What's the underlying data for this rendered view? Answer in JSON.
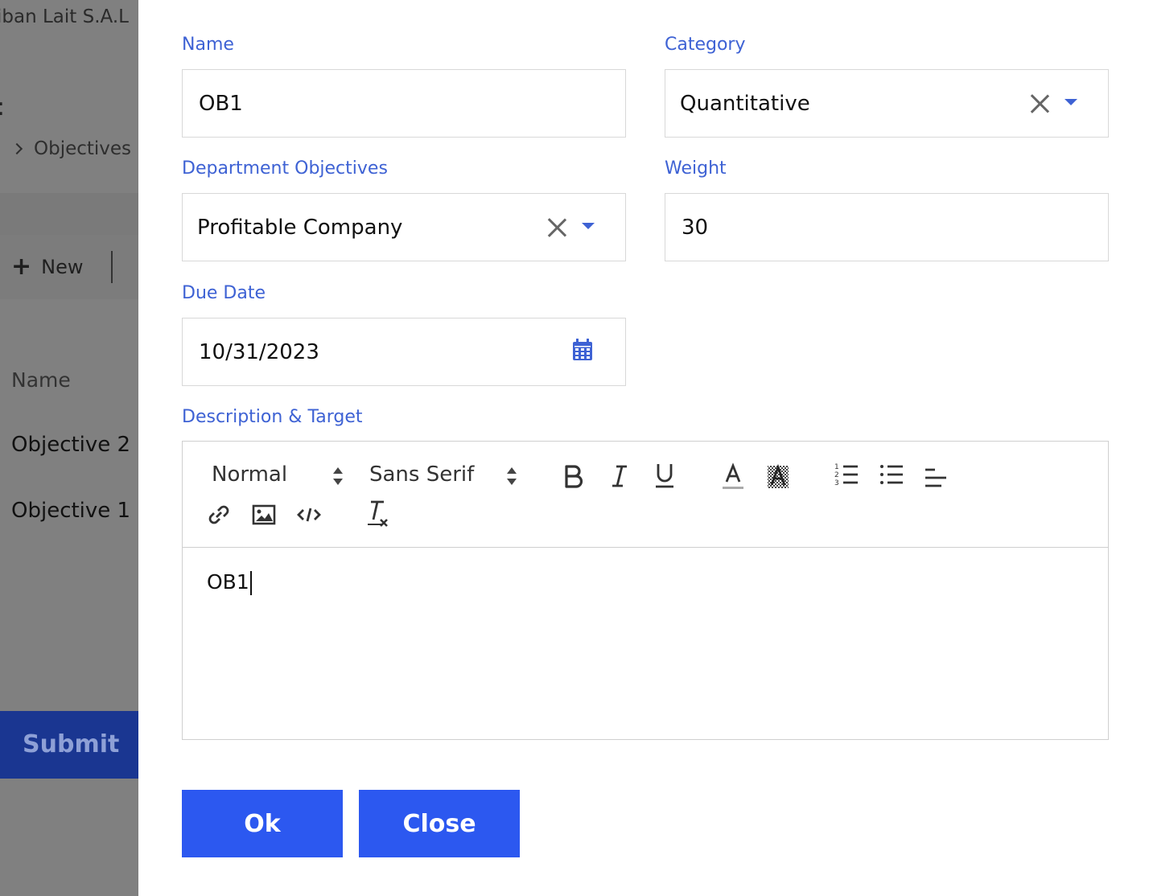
{
  "background": {
    "company_name": "iban Lait S.A.L",
    "colon": ":",
    "breadcrumb_item": "Objectives",
    "new_label": "New",
    "column_name": "Name",
    "rows": [
      "Objective 2",
      "Objective 1"
    ],
    "submit_label": "Submit"
  },
  "form": {
    "name": {
      "label": "Name",
      "value": "OB1"
    },
    "category": {
      "label": "Category",
      "value": "Quantitative"
    },
    "department_objectives": {
      "label": "Department Objectives",
      "value": "Profitable Company"
    },
    "weight": {
      "label": "Weight",
      "value": "30"
    },
    "due_date": {
      "label": "Due Date",
      "value": "10/31/2023",
      "icon": "calendar-icon"
    },
    "description": {
      "label": "Description & Target",
      "toolbar": {
        "header_picker": "Normal",
        "font_picker": "Sans Serif",
        "icons": [
          "bold-icon",
          "italic-icon",
          "underline-icon",
          "text-color-icon",
          "background-color-icon",
          "ordered-list-icon",
          "bullet-list-icon",
          "align-icon",
          "link-icon",
          "image-icon",
          "code-icon",
          "clear-format-icon"
        ]
      },
      "content": "OB1"
    }
  },
  "buttons": {
    "ok": "Ok",
    "close": "Close"
  },
  "colors": {
    "accent": "#3e62d4",
    "primary_button": "#2c58f0",
    "overlay": "#808080",
    "submit_bg": "#1a3691"
  }
}
